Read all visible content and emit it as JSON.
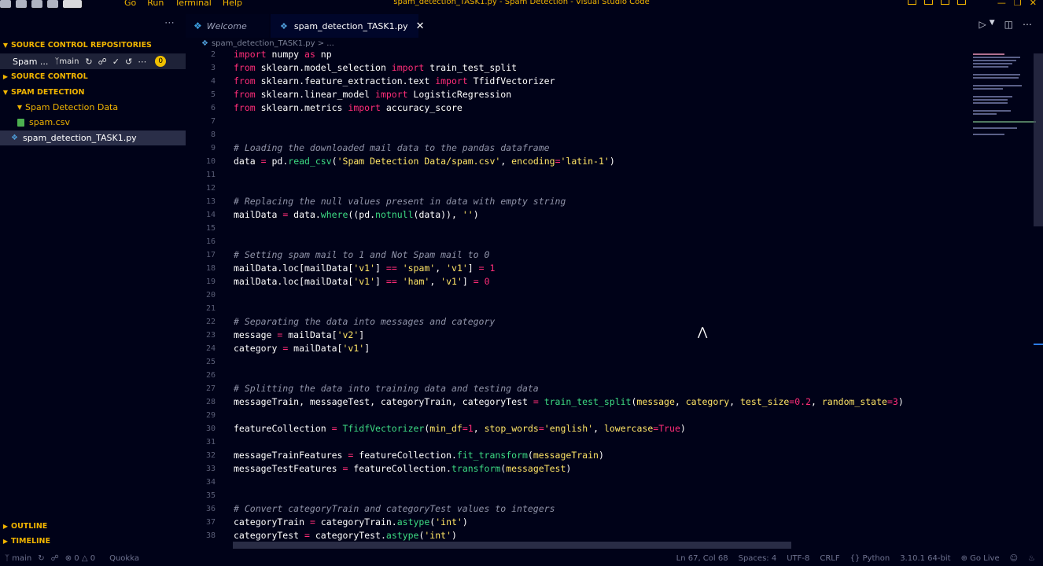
{
  "window": {
    "title": "spam_detection_TASK1.py - Spam Detection - Visual Studio Code",
    "menu": [
      "Go",
      "Run",
      "Terminal",
      "Help"
    ]
  },
  "sidebar": {
    "sections": {
      "source_control_repositories": "SOURCE CONTROL REPOSITORIES",
      "source_control": "SOURCE CONTROL",
      "spam_detection": "SPAM DETECTION",
      "outline": "OUTLINE",
      "timeline": "TIMELINE"
    },
    "repo": {
      "name": "Spam ...",
      "branch": "main",
      "badge": "0"
    },
    "tree": {
      "folder": "Spam Detection Data",
      "csv": "spam.csv",
      "py": "spam_detection_TASK1.py"
    }
  },
  "tabs": {
    "welcome": "Welcome",
    "file": "spam_detection_TASK1.py"
  },
  "breadcrumb": {
    "file": "spam_detection_TASK1.py",
    "sep": "> ..."
  },
  "code": {
    "ln": [
      "2",
      "3",
      "4",
      "5",
      "6",
      "7",
      "8",
      "9",
      "10",
      "11",
      "12",
      "13",
      "14",
      "15",
      "16",
      "17",
      "18",
      "19",
      "20",
      "21",
      "22",
      "23",
      "24",
      "25",
      "26",
      "27",
      "28",
      "29",
      "30",
      "31",
      "32",
      "33",
      "34",
      "35",
      "36",
      "37",
      "38"
    ],
    "l2": {
      "a": "import",
      "b": " numpy ",
      "c": "as",
      "d": " np"
    },
    "l3": {
      "a": "from",
      "b": " sklearn.model_selection ",
      "c": "import",
      "d": " train_test_split"
    },
    "l4": {
      "a": "from",
      "b": " sklearn.feature_extraction.text ",
      "c": "import",
      "d": " TfidfVectorizer"
    },
    "l5": {
      "a": "from",
      "b": " sklearn.linear_model ",
      "c": "import",
      "d": " LogisticRegression"
    },
    "l6": {
      "a": "from",
      "b": " sklearn.metrics ",
      "c": "import",
      "d": " accuracy_score"
    },
    "l9": "# Loading the downloaded mail data to the pandas dataframe",
    "l10": {
      "a": "data ",
      "b": "=",
      "c": " pd.",
      "d": "read_csv",
      "e": "(",
      "f": "'Spam Detection Data/spam.csv'",
      "g": ", ",
      "h": "encoding",
      "i": "=",
      "j": "'latin-1'",
      "k": ")"
    },
    "l13": "# Replacing the null values present in data with empty string",
    "l14": {
      "a": "mailData ",
      "b": "=",
      "c": " data.",
      "d": "where",
      "e": "((pd.",
      "f": "notnull",
      "g": "(data)), ",
      "h": "''",
      "i": ")"
    },
    "l17": "# Setting spam mail to 1 and Not Spam mail to 0",
    "l18": {
      "a": "mailData.loc[mailData[",
      "b": "'v1'",
      "c": "] ",
      "d": "==",
      "e": " ",
      "f": "'spam'",
      "g": ", ",
      "h": "'v1'",
      "i": "] ",
      "j": "=",
      "k": " ",
      "l": "1"
    },
    "l19": {
      "a": "mailData.loc[mailData[",
      "b": "'v1'",
      "c": "] ",
      "d": "==",
      "e": " ",
      "f": "'ham'",
      "g": ", ",
      "h": "'v1'",
      "i": "] ",
      "j": "=",
      "k": " ",
      "l": "0"
    },
    "l22": "# Separating the data into messages and category",
    "l23": {
      "a": "message ",
      "b": "=",
      "c": " mailData[",
      "d": "'v2'",
      "e": "]"
    },
    "l24": {
      "a": "category ",
      "b": "=",
      "c": " mailData[",
      "d": "'v1'",
      "e": "]"
    },
    "l27": "# Splitting the data into training data and testing data",
    "l28": {
      "a": "messageTrain, messageTest, categoryTrain, categoryTest ",
      "b": "=",
      "c": " ",
      "d": "train_test_split",
      "e": "(",
      "f": "message",
      "g": ", ",
      "h": "category",
      "i": ", ",
      "j": "test_size",
      "k": "=",
      "l": "0.2",
      "m": ", ",
      "n": "random_state",
      "o": "=",
      "p": "3",
      "q": ")"
    },
    "l30": {
      "a": "featureCollection ",
      "b": "=",
      "c": " ",
      "d": "TfidfVectorizer",
      "e": "(",
      "f": "min_df",
      "g": "=",
      "h": "1",
      "i": ", ",
      "j": "stop_words",
      "k": "=",
      "l": "'english'",
      "m": ", ",
      "n": "lowercase",
      "o": "=",
      "p": "True",
      "q": ")"
    },
    "l32": {
      "a": "messageTrainFeatures ",
      "b": "=",
      "c": " featureCollection.",
      "d": "fit_transform",
      "e": "(",
      "f": "messageTrain",
      "g": ")"
    },
    "l33": {
      "a": "messageTestFeatures ",
      "b": "=",
      "c": " featureCollection.",
      "d": "transform",
      "e": "(",
      "f": "messageTest",
      "g": ")"
    },
    "l36": "# Convert categoryTrain and categoryTest values to integers",
    "l37": {
      "a": "categoryTrain ",
      "b": "=",
      "c": " categoryTrain.",
      "d": "astype",
      "e": "(",
      "f": "'int'",
      "g": ")"
    },
    "l38": {
      "a": "categoryTest ",
      "b": "=",
      "c": " categoryTest.",
      "d": "astype",
      "e": "(",
      "f": "'int'",
      "g": ")"
    }
  },
  "status": {
    "branch": "main",
    "problems": "0",
    "warnings": "0",
    "quokka": "Quokka",
    "position": "Ln 67, Col 68",
    "spaces": "Spaces: 4",
    "encoding": "UTF-8",
    "eol": "CRLF",
    "language": "Python",
    "interpreter": "3.10.1 64-bit",
    "golive": "Go Live"
  },
  "colors": {
    "background": "#000218",
    "keyword": "#ff2d78",
    "function": "#3ddc84",
    "string": "#ffe566",
    "accent": "#f0b400"
  }
}
